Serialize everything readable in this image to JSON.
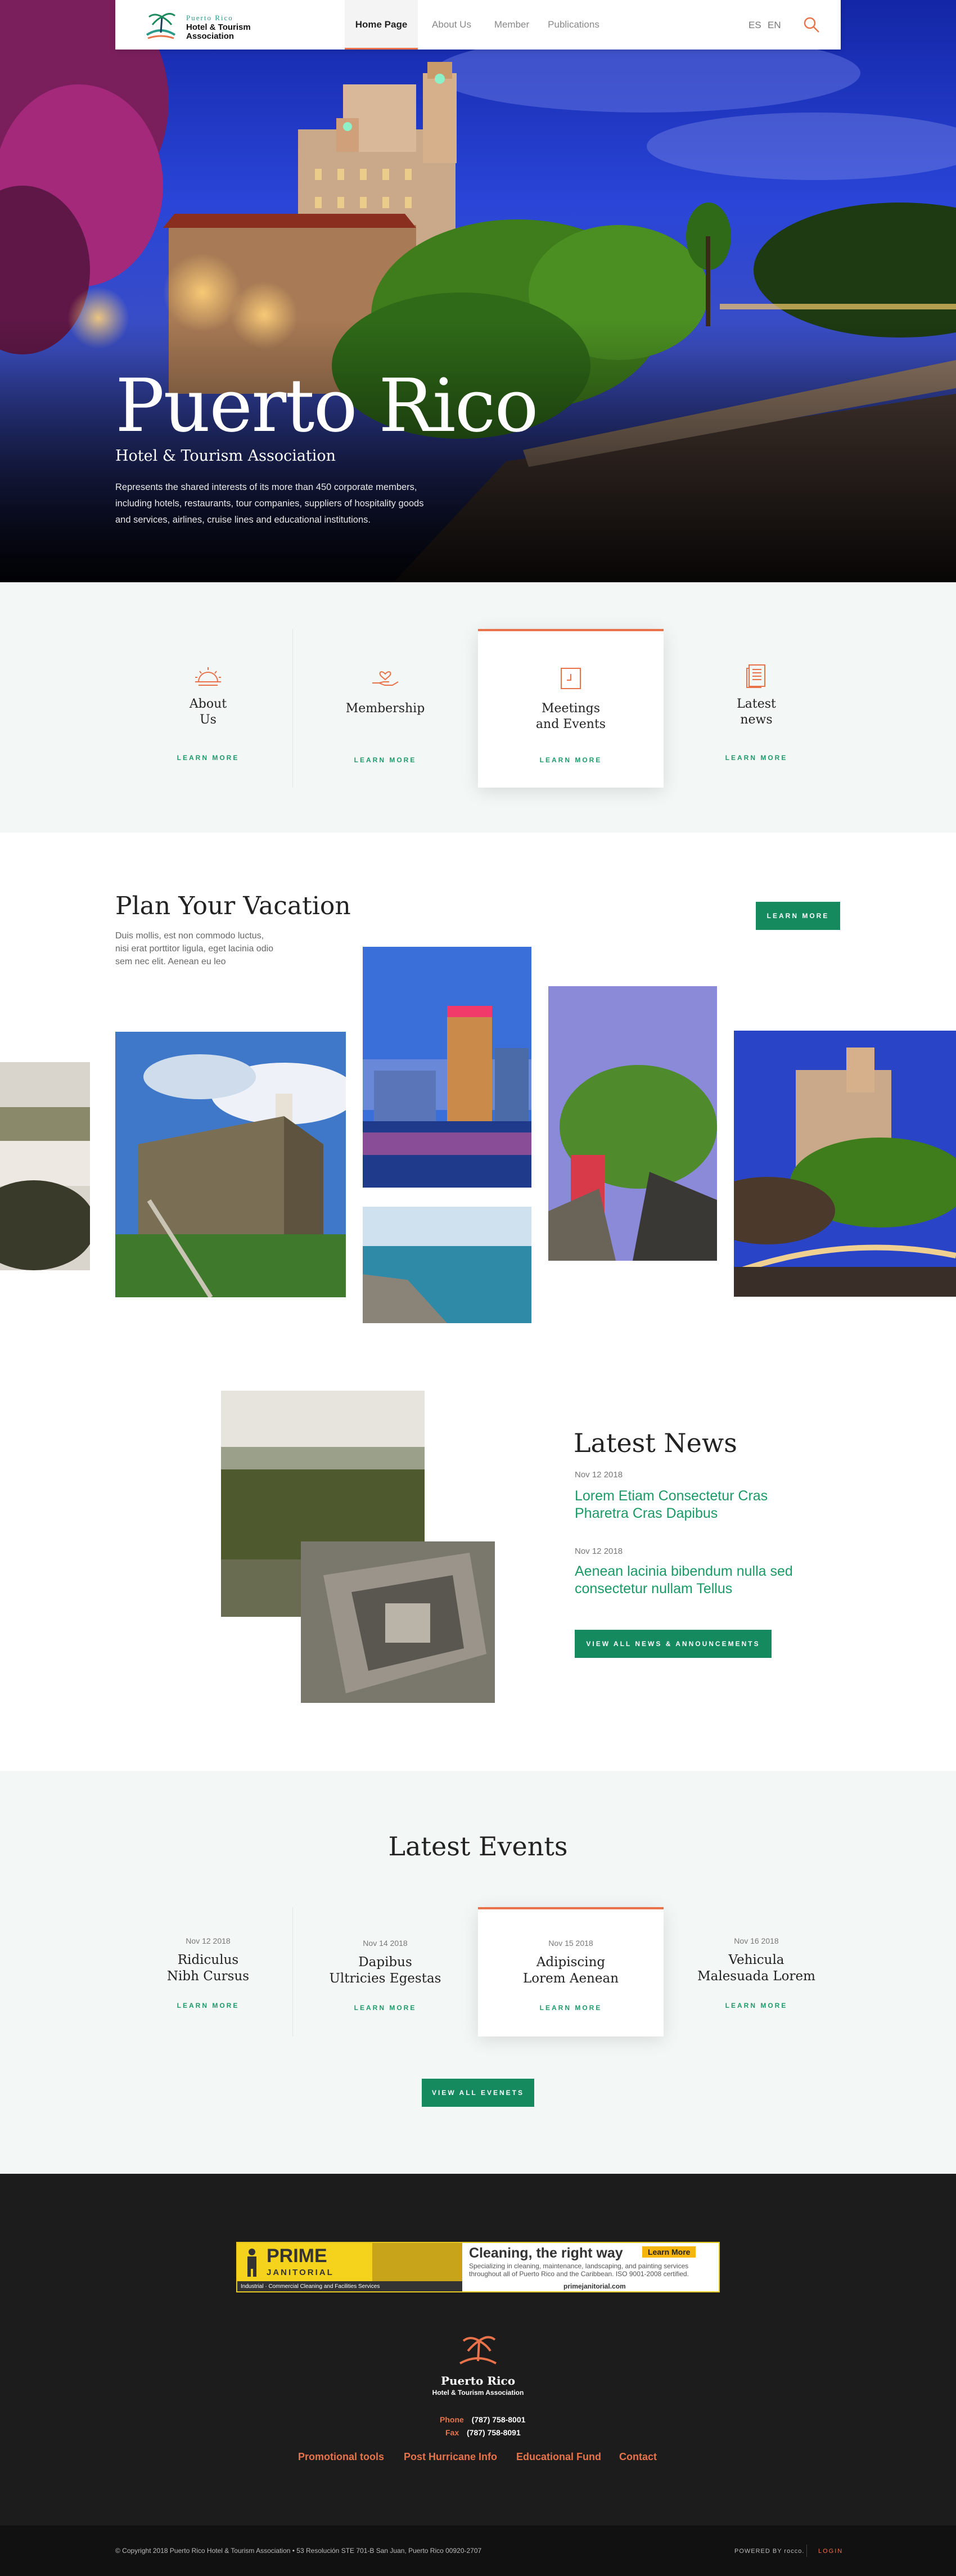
{
  "header": {
    "logo": {
      "small": "Puerto Rico",
      "line1": "Hotel & Tourism",
      "line2": "Association"
    },
    "nav": [
      "Home Page",
      "About Us",
      "Member",
      "Publications"
    ],
    "lang": [
      "ES",
      "EN"
    ],
    "icons": {
      "search": "search-icon"
    }
  },
  "hero": {
    "title": "Puerto Rico",
    "subtitle": "Hotel & Tourism Association",
    "description": "Represents the shared interests of its more than 450 corporate members, including hotels, restaurants, tour companies, suppliers of hospitality goods and services, airlines, cruise lines and educational institutions."
  },
  "services": [
    {
      "label": "About\nUs",
      "link": "LEARN MORE",
      "icon": "sunrise-icon"
    },
    {
      "label": "Membership",
      "link": "LEARN MORE",
      "icon": "hand-heart-icon"
    },
    {
      "label": "Meetings\nand Events",
      "link": "LEARN MORE",
      "icon": "calendar-icon"
    },
    {
      "label": "Latest\nnews",
      "link": "LEARN MORE",
      "icon": "document-icon"
    }
  ],
  "plan": {
    "title": "Plan Your Vacation",
    "description": "Duis mollis, est non commodo luctus, nisi erat porttitor ligula, eget lacinia odio sem nec elit. Aenean eu leo",
    "button": "LEARN MORE"
  },
  "news": {
    "title": "Latest News",
    "items": [
      {
        "date": "Nov 12 2018",
        "headline": "Lorem Etiam Consectetur Cras Pharetra Cras Dapibus"
      },
      {
        "date": "Nov 12 2018",
        "headline": "Aenean lacinia bibendum nulla sed consectetur nullam Tellus"
      }
    ],
    "button": "VIEW ALL NEWS & ANNOUNCEMENTS"
  },
  "events": {
    "title": "Latest Events",
    "items": [
      {
        "date": "Nov 12 2018",
        "title": "Ridiculus\nNibh Cursus",
        "link": "LEARN MORE"
      },
      {
        "date": "Nov 14 2018",
        "title": "Dapibus\nUltricies Egestas",
        "link": "LEARN MORE"
      },
      {
        "date": "Nov 15 2018",
        "title": "Adipiscing\nLorem Aenean",
        "link": "LEARN MORE"
      },
      {
        "date": "Nov 16 2018",
        "title": "Vehicula\nMalesuada Lorem",
        "link": "LEARN MORE"
      }
    ],
    "button": "VIEW ALL EVENETS"
  },
  "ad": {
    "brand": "PRIME",
    "brand_sub": "JANITORIAL",
    "tagline": "Industrial · Commercial Cleaning and Facilities Services",
    "headline": "Cleaning, the right way",
    "cta": "Learn More",
    "body": "Specializing in cleaning, maintenance, landscaping, and painting services throughout all of Puerto Rico and the Caribbean. ISO 9001-2008 certified.",
    "url": "primejanitorial.com"
  },
  "footer": {
    "logo_title": "Puerto Rico",
    "logo_sub": "Hotel & Tourism Association",
    "phone_label": "Phone",
    "phone": "(787) 758-8001",
    "fax_label": "Fax",
    "fax": "(787) 758-8091",
    "links": [
      "Promotional tools",
      "Post Hurricane Info",
      "Educational Fund",
      "Contact"
    ],
    "copyright": "© Copyright 2018 Puerto Rico Hotel & Tourism Association  •  53 Resolución STE 701-B San Juan, Puerto Rico 00920-2707",
    "powered": "POWERED BY rocco.",
    "login": "LOGIN"
  },
  "colors": {
    "accent": "#e8734a",
    "green": "#148a5e",
    "footer": "#1c1c1c"
  }
}
